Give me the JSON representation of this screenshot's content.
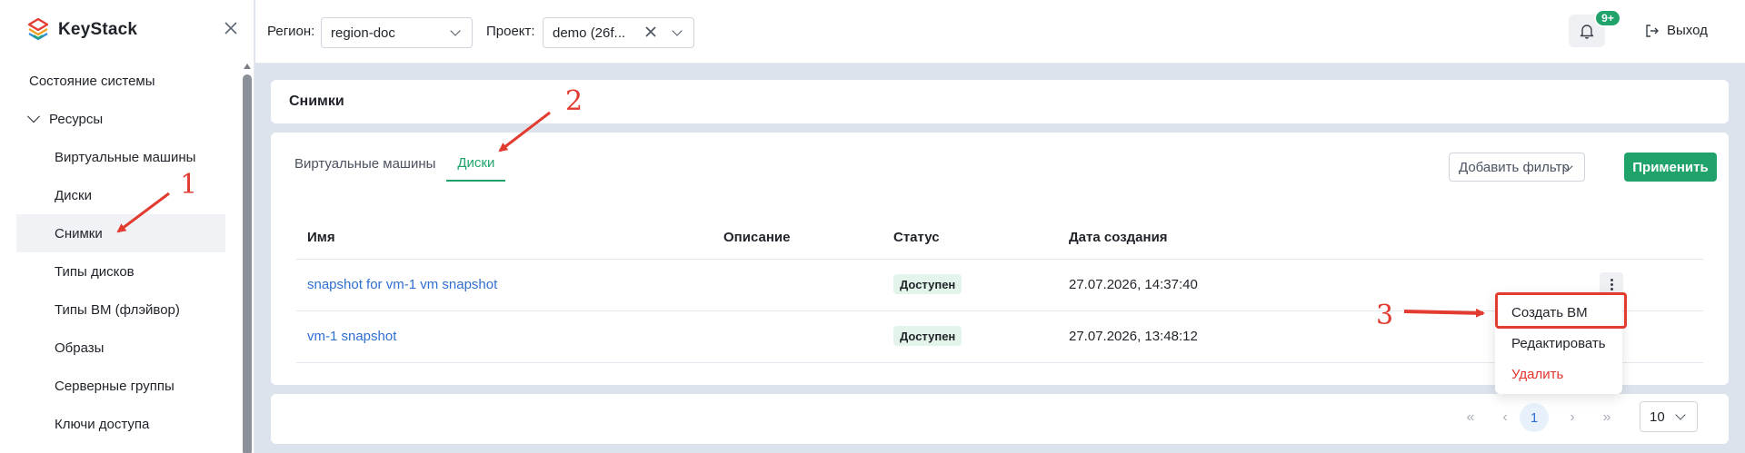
{
  "app": {
    "name": "KeyStack"
  },
  "sidebar": {
    "items": [
      {
        "label": "Состояние системы"
      },
      {
        "label": "Ресурсы"
      },
      {
        "label": "Виртуальные машины"
      },
      {
        "label": "Диски"
      },
      {
        "label": "Снимки"
      },
      {
        "label": "Типы дисков"
      },
      {
        "label": "Типы ВМ (флэйвор)"
      },
      {
        "label": "Образы"
      },
      {
        "label": "Серверные группы"
      },
      {
        "label": "Ключи доступа"
      }
    ]
  },
  "header": {
    "region_label": "Регион:",
    "region_value": "region-doc",
    "project_label": "Проект:",
    "project_value": "demo (26f...",
    "notifications_badge": "9+",
    "logout_label": "Выход"
  },
  "page": {
    "title": "Снимки"
  },
  "tabs": [
    {
      "label": "Виртуальные машины"
    },
    {
      "label": "Диски"
    }
  ],
  "filter": {
    "placeholder": "Добавить фильтр",
    "apply_label": "Применить"
  },
  "table": {
    "columns": [
      "Имя",
      "Описание",
      "Статус",
      "Дата создания"
    ],
    "rows": [
      {
        "name": "snapshot for vm-1 vm snapshot",
        "description": "",
        "status": "Доступен",
        "created": "27.07.2026, 14:37:40"
      },
      {
        "name": "vm-1 snapshot",
        "description": "",
        "status": "Доступен",
        "created": "27.07.2026, 13:48:12"
      }
    ]
  },
  "menu": {
    "items": [
      {
        "label": "Создать ВМ"
      },
      {
        "label": "Редактировать"
      },
      {
        "label": "Удалить"
      }
    ]
  },
  "pagination": {
    "current": "1",
    "page_size": "10"
  },
  "annotations": [
    "1",
    "2",
    "3"
  ],
  "colors": {
    "accent": "#20a36b",
    "link": "#2f6fd1",
    "danger": "#e2342c",
    "annotation": "#e23b30"
  }
}
